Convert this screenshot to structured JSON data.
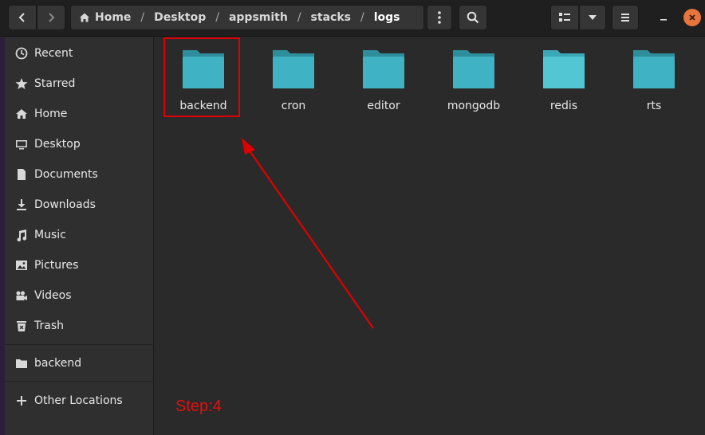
{
  "breadcrumb": {
    "items": [
      "Home",
      "Desktop",
      "appsmith",
      "stacks",
      "logs"
    ],
    "separator": "/"
  },
  "sidebar": {
    "items": [
      {
        "label": "Recent",
        "icon": "clock-icon"
      },
      {
        "label": "Starred",
        "icon": "star-icon"
      },
      {
        "label": "Home",
        "icon": "home-icon"
      },
      {
        "label": "Desktop",
        "icon": "desktop-icon"
      },
      {
        "label": "Documents",
        "icon": "document-icon"
      },
      {
        "label": "Downloads",
        "icon": "download-icon"
      },
      {
        "label": "Music",
        "icon": "music-icon"
      },
      {
        "label": "Pictures",
        "icon": "picture-icon"
      },
      {
        "label": "Videos",
        "icon": "video-icon"
      },
      {
        "label": "Trash",
        "icon": "trash-icon"
      }
    ],
    "bookmarks": [
      {
        "label": "backend",
        "icon": "folder-icon"
      }
    ],
    "other": {
      "label": "Other Locations",
      "icon": "plus-icon"
    }
  },
  "folders": [
    "backend",
    "cron",
    "editor",
    "mongodb",
    "redis",
    "rts"
  ],
  "annotation": {
    "step_label": "Step:4",
    "color": "#e00000"
  },
  "colors": {
    "folder": "#3fb3c3",
    "folder_light": "#52c6d2",
    "accent_close": "#e8753b"
  }
}
